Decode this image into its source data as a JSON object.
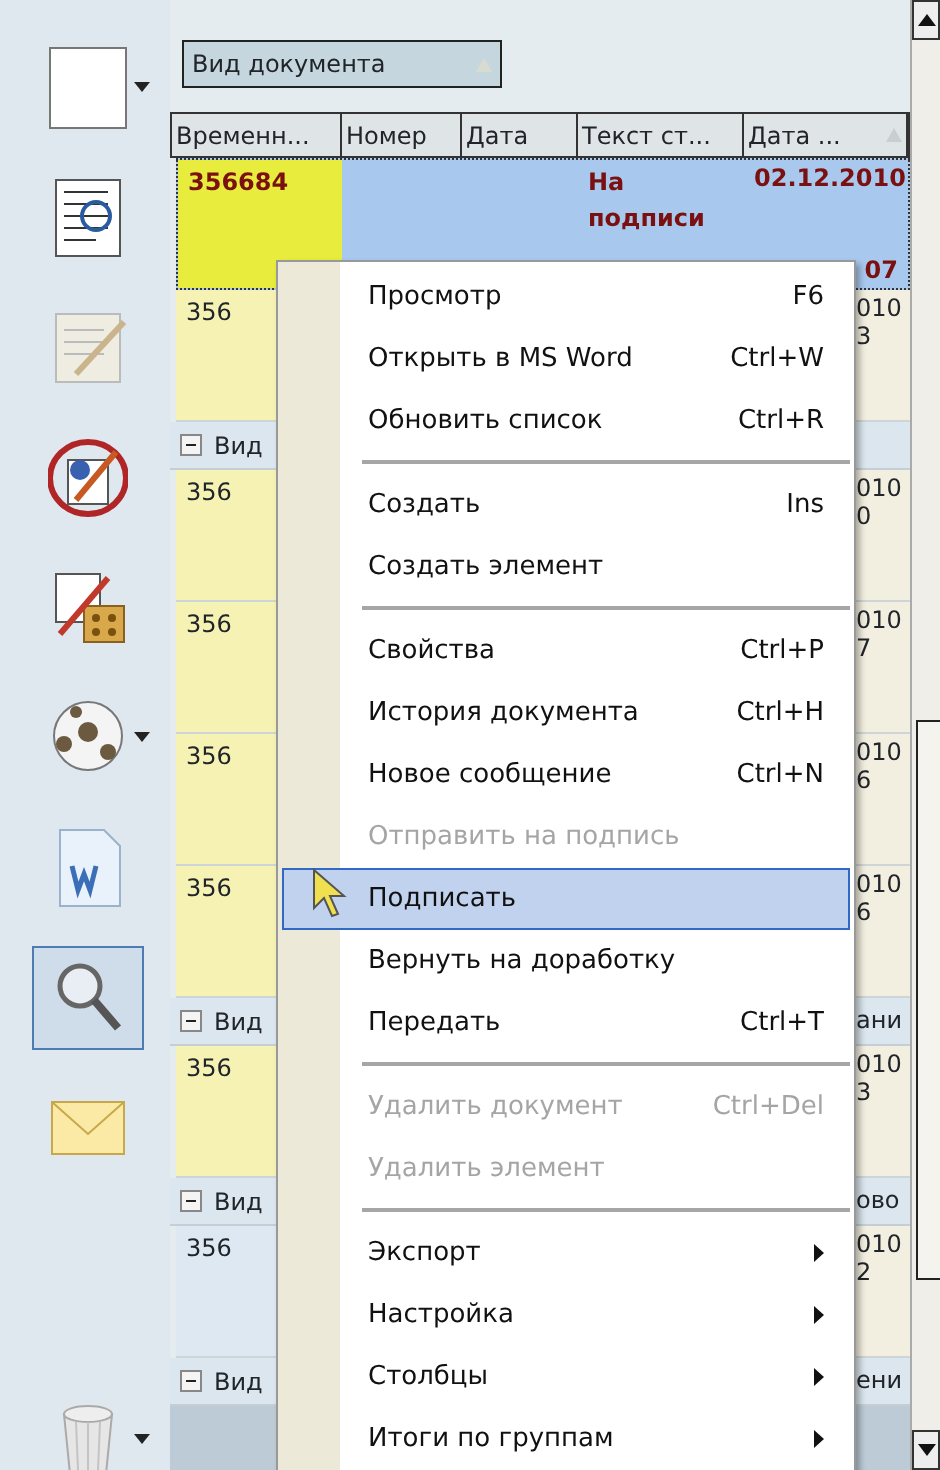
{
  "toolbar": [
    {
      "selected": false,
      "dropdown": true
    },
    {
      "selected": false,
      "dropdown": false
    },
    {
      "selected": false,
      "dropdown": false
    },
    {
      "selected": false,
      "dropdown": false
    },
    {
      "selected": false,
      "dropdown": false
    },
    {
      "selected": false,
      "dropdown": true
    },
    {
      "selected": false,
      "dropdown": false
    },
    {
      "selected": true,
      "dropdown": false
    },
    {
      "selected": false,
      "dropdown": false
    },
    {
      "selected": false,
      "dropdown": true
    }
  ],
  "group_by": {
    "label": "Вид документа"
  },
  "table": {
    "columns": [
      "Временн...",
      "Номер",
      "Дата",
      "Текст ст...",
      "Дата ..."
    ],
    "rows": [
      {
        "kind": "record",
        "selected": true,
        "color": "#e8ec3c",
        "cells": [
          "356684",
          "",
          "",
          "На подписи",
          "02.12.2010"
        ],
        "tail": [
          "07"
        ]
      },
      {
        "kind": "record",
        "selected": false,
        "color": "#f5f2b4",
        "cells": [
          "356"
        ],
        "tail": [
          "010",
          "3"
        ]
      },
      {
        "kind": "group",
        "label": "Вид",
        "tail": []
      },
      {
        "kind": "record",
        "selected": false,
        "color": "#f5f2b4",
        "cells": [
          "356"
        ],
        "tail": [
          "010",
          "0"
        ]
      },
      {
        "kind": "record",
        "selected": false,
        "color": "#f5f2b4",
        "cells": [
          "356"
        ],
        "tail": [
          "010",
          "7"
        ]
      },
      {
        "kind": "record",
        "selected": false,
        "color": "#f5f2b4",
        "cells": [
          "356"
        ],
        "tail": [
          "010",
          "6"
        ]
      },
      {
        "kind": "record",
        "selected": false,
        "color": "#f5f2b4",
        "cells": [
          "356"
        ],
        "tail": [
          "010",
          "6"
        ]
      },
      {
        "kind": "group",
        "label": "Вид",
        "tail": [
          "ани"
        ]
      },
      {
        "kind": "record",
        "selected": false,
        "color": "#f5f2b4",
        "cells": [
          "356"
        ],
        "tail": [
          "010",
          "3"
        ]
      },
      {
        "kind": "group",
        "label": "Вид",
        "tail": [
          "ово"
        ]
      },
      {
        "kind": "record",
        "selected": false,
        "color": "#dde8f3",
        "cells": [
          "356"
        ],
        "tail": [
          "010",
          "2"
        ]
      },
      {
        "kind": "group",
        "label": "Вид",
        "tail": [
          "ени"
        ]
      }
    ]
  },
  "context_menu": [
    {
      "kind": "item",
      "label": "Просмотр",
      "shortcut": "F6",
      "disabled": false,
      "selected": false,
      "submenu": false
    },
    {
      "kind": "item",
      "label": "Открыть в MS Word",
      "shortcut": "Ctrl+W",
      "disabled": false,
      "selected": false,
      "submenu": false
    },
    {
      "kind": "item",
      "label": "Обновить список",
      "shortcut": "Ctrl+R",
      "disabled": false,
      "selected": false,
      "submenu": false
    },
    {
      "kind": "separator"
    },
    {
      "kind": "item",
      "label": "Создать",
      "shortcut": "Ins",
      "disabled": false,
      "selected": false,
      "submenu": false
    },
    {
      "kind": "item",
      "label": "Создать элемент",
      "disabled": false,
      "selected": false,
      "submenu": false
    },
    {
      "kind": "separator"
    },
    {
      "kind": "item",
      "label": "Свойства",
      "shortcut": "Ctrl+P",
      "disabled": false,
      "selected": false,
      "submenu": false
    },
    {
      "kind": "item",
      "label": "История документа",
      "shortcut": "Ctrl+H",
      "disabled": false,
      "selected": false,
      "submenu": false
    },
    {
      "kind": "item",
      "label": "Новое сообщение",
      "shortcut": "Ctrl+N",
      "disabled": false,
      "selected": false,
      "submenu": false
    },
    {
      "kind": "item",
      "label": "Отправить на подпись",
      "disabled": true,
      "selected": false,
      "submenu": false
    },
    {
      "kind": "item",
      "label": "Подписать",
      "disabled": false,
      "selected": true,
      "submenu": false
    },
    {
      "kind": "item",
      "label": "Вернуть на доработку",
      "disabled": false,
      "selected": false,
      "submenu": false
    },
    {
      "kind": "item",
      "label": "Передать",
      "shortcut": "Ctrl+T",
      "disabled": false,
      "selected": false,
      "submenu": false
    },
    {
      "kind": "separator"
    },
    {
      "kind": "item",
      "label": "Удалить документ",
      "shortcut": "Ctrl+Del",
      "disabled": true,
      "selected": false,
      "submenu": false
    },
    {
      "kind": "item",
      "label": "Удалить элемент",
      "disabled": true,
      "selected": false,
      "submenu": false
    },
    {
      "kind": "separator"
    },
    {
      "kind": "item",
      "label": "Экспорт",
      "disabled": false,
      "selected": false,
      "submenu": true
    },
    {
      "kind": "item",
      "label": "Настройка",
      "disabled": false,
      "selected": false,
      "submenu": true
    },
    {
      "kind": "item",
      "label": "Столбцы",
      "disabled": false,
      "selected": false,
      "submenu": true
    },
    {
      "kind": "item",
      "label": "Итоги по группам",
      "disabled": false,
      "selected": false,
      "submenu": true
    }
  ]
}
